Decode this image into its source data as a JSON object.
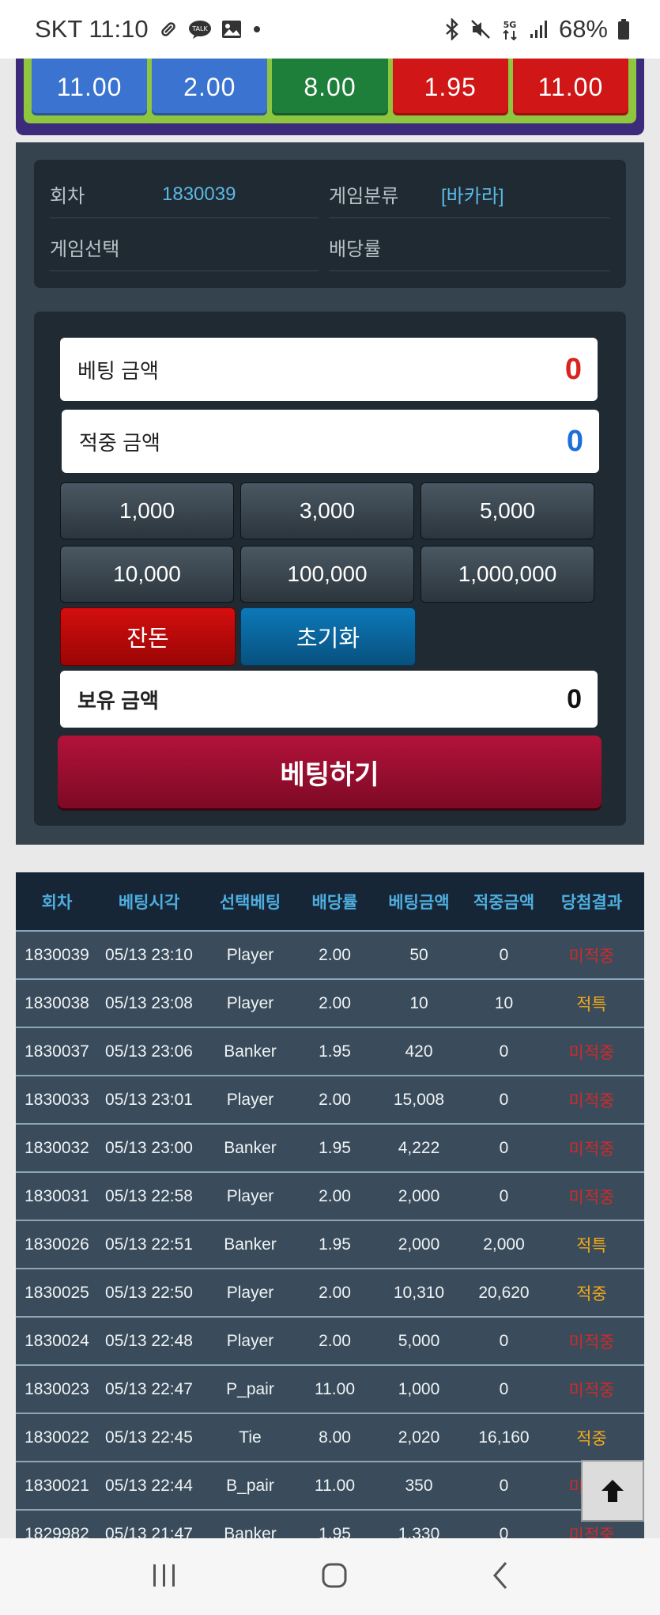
{
  "status_bar": {
    "carrier_time": "SKT 11:10",
    "battery": "68%",
    "icons_left": [
      "pill-icon",
      "talk-icon",
      "image-icon",
      "dot-icon"
    ],
    "icons_right": [
      "bluetooth-icon",
      "mute-icon",
      "5g-icon",
      "signal-icon",
      "battery-icon"
    ]
  },
  "odds": [
    {
      "value": "11.00",
      "color": "#3a73d0"
    },
    {
      "value": "2.00",
      "color": "#3a73d0"
    },
    {
      "value": "8.00",
      "color": "#1e7f3a"
    },
    {
      "value": "1.95",
      "color": "#d01616"
    },
    {
      "value": "11.00",
      "color": "#d01616"
    }
  ],
  "info": {
    "round_label": "회차",
    "round_value": "1830039",
    "category_label": "게임분류",
    "category_value": "[바카라]",
    "selection_label": "게임선택",
    "odds_label": "배당률"
  },
  "form": {
    "bet_amount_label": "베팅 금액",
    "bet_amount_value": "0",
    "hit_amount_label": "적중 금액",
    "hit_amount_value": "0",
    "chips": [
      "1,000",
      "3,000",
      "5,000",
      "10,000",
      "100,000",
      "1,000,000"
    ],
    "change_label": "잔돈",
    "reset_label": "초기화",
    "holding_label": "보유 금액",
    "holding_value": "0",
    "submit_label": "베팅하기"
  },
  "history": {
    "headers": [
      "회차",
      "베팅시각",
      "선택베팅",
      "배당률",
      "베팅금액",
      "적중금액",
      "당첨결과"
    ],
    "rows": [
      [
        "1830039",
        "05/13 23:10",
        "Player",
        "2.00",
        "50",
        "0",
        "미적중"
      ],
      [
        "1830038",
        "05/13 23:08",
        "Player",
        "2.00",
        "10",
        "10",
        "적특"
      ],
      [
        "1830037",
        "05/13 23:06",
        "Banker",
        "1.95",
        "420",
        "0",
        "미적중"
      ],
      [
        "1830033",
        "05/13 23:01",
        "Player",
        "2.00",
        "15,008",
        "0",
        "미적중"
      ],
      [
        "1830032",
        "05/13 23:00",
        "Banker",
        "1.95",
        "4,222",
        "0",
        "미적중"
      ],
      [
        "1830031",
        "05/13 22:58",
        "Player",
        "2.00",
        "2,000",
        "0",
        "미적중"
      ],
      [
        "1830026",
        "05/13 22:51",
        "Banker",
        "1.95",
        "2,000",
        "2,000",
        "적특"
      ],
      [
        "1830025",
        "05/13 22:50",
        "Player",
        "2.00",
        "10,310",
        "20,620",
        "적중"
      ],
      [
        "1830024",
        "05/13 22:48",
        "Player",
        "2.00",
        "5,000",
        "0",
        "미적중"
      ],
      [
        "1830023",
        "05/13 22:47",
        "P_pair",
        "11.00",
        "1,000",
        "0",
        "미적중"
      ],
      [
        "1830022",
        "05/13 22:45",
        "Tie",
        "8.00",
        "2,020",
        "16,160",
        "적중"
      ],
      [
        "1830021",
        "05/13 22:44",
        "B_pair",
        "11.00",
        "350",
        "0",
        "미적중"
      ],
      [
        "1829982",
        "05/13 21:47",
        "Banker",
        "1.95",
        "1,330",
        "0",
        "미적중"
      ]
    ]
  },
  "colors": {
    "bet_amount": "#d8231f",
    "hit_amount": "#1e6fd9",
    "lose": "#cc2b2b",
    "win": "#f0a81a"
  }
}
